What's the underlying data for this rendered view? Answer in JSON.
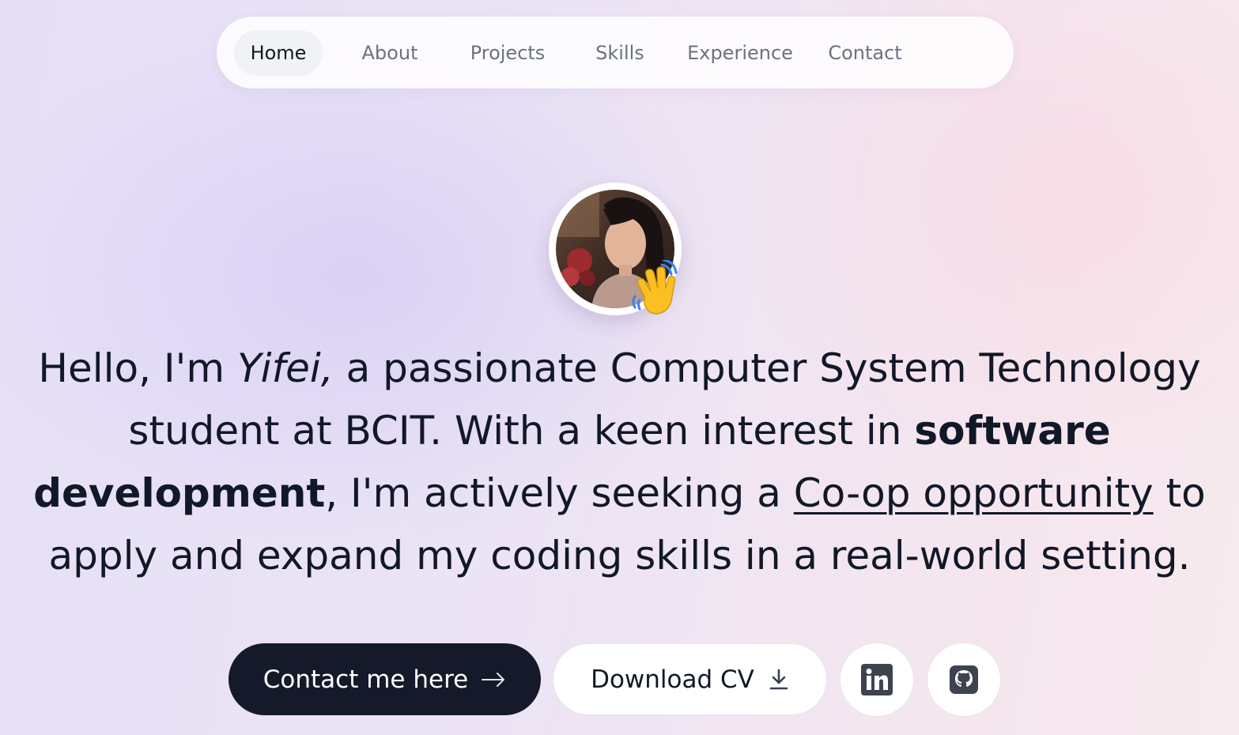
{
  "nav": {
    "items": [
      {
        "label": "Home",
        "active": true
      },
      {
        "label": "About",
        "active": false
      },
      {
        "label": "Projects",
        "active": false
      },
      {
        "label": "Skills",
        "active": false
      },
      {
        "label": "Experience",
        "active": false
      },
      {
        "label": "Contact",
        "active": false
      }
    ]
  },
  "hero": {
    "avatar_icon": "profile-photo",
    "wave_icon": "waving-hand-emoji",
    "intro": {
      "p1": "Hello, I'm ",
      "name": "Yifei,",
      "p2": " a passionate Computer System Technology student at BCIT. With a keen interest in ",
      "highlight": "software development",
      "p3": ", I'm actively seeking a ",
      "link": "Co-op opportunity",
      "p4": " to apply and expand my coding skills in a real-world setting."
    }
  },
  "actions": {
    "contact_label": "Contact me here",
    "contact_icon": "arrow-right-icon",
    "download_label": "Download CV",
    "download_icon": "download-icon",
    "linkedin_icon": "linkedin-icon",
    "github_icon": "github-icon"
  },
  "colors": {
    "text": "#111827",
    "muted": "#6b7280",
    "dark_button": "#141a2a",
    "nav_active_bg": "#f1f2f4"
  }
}
